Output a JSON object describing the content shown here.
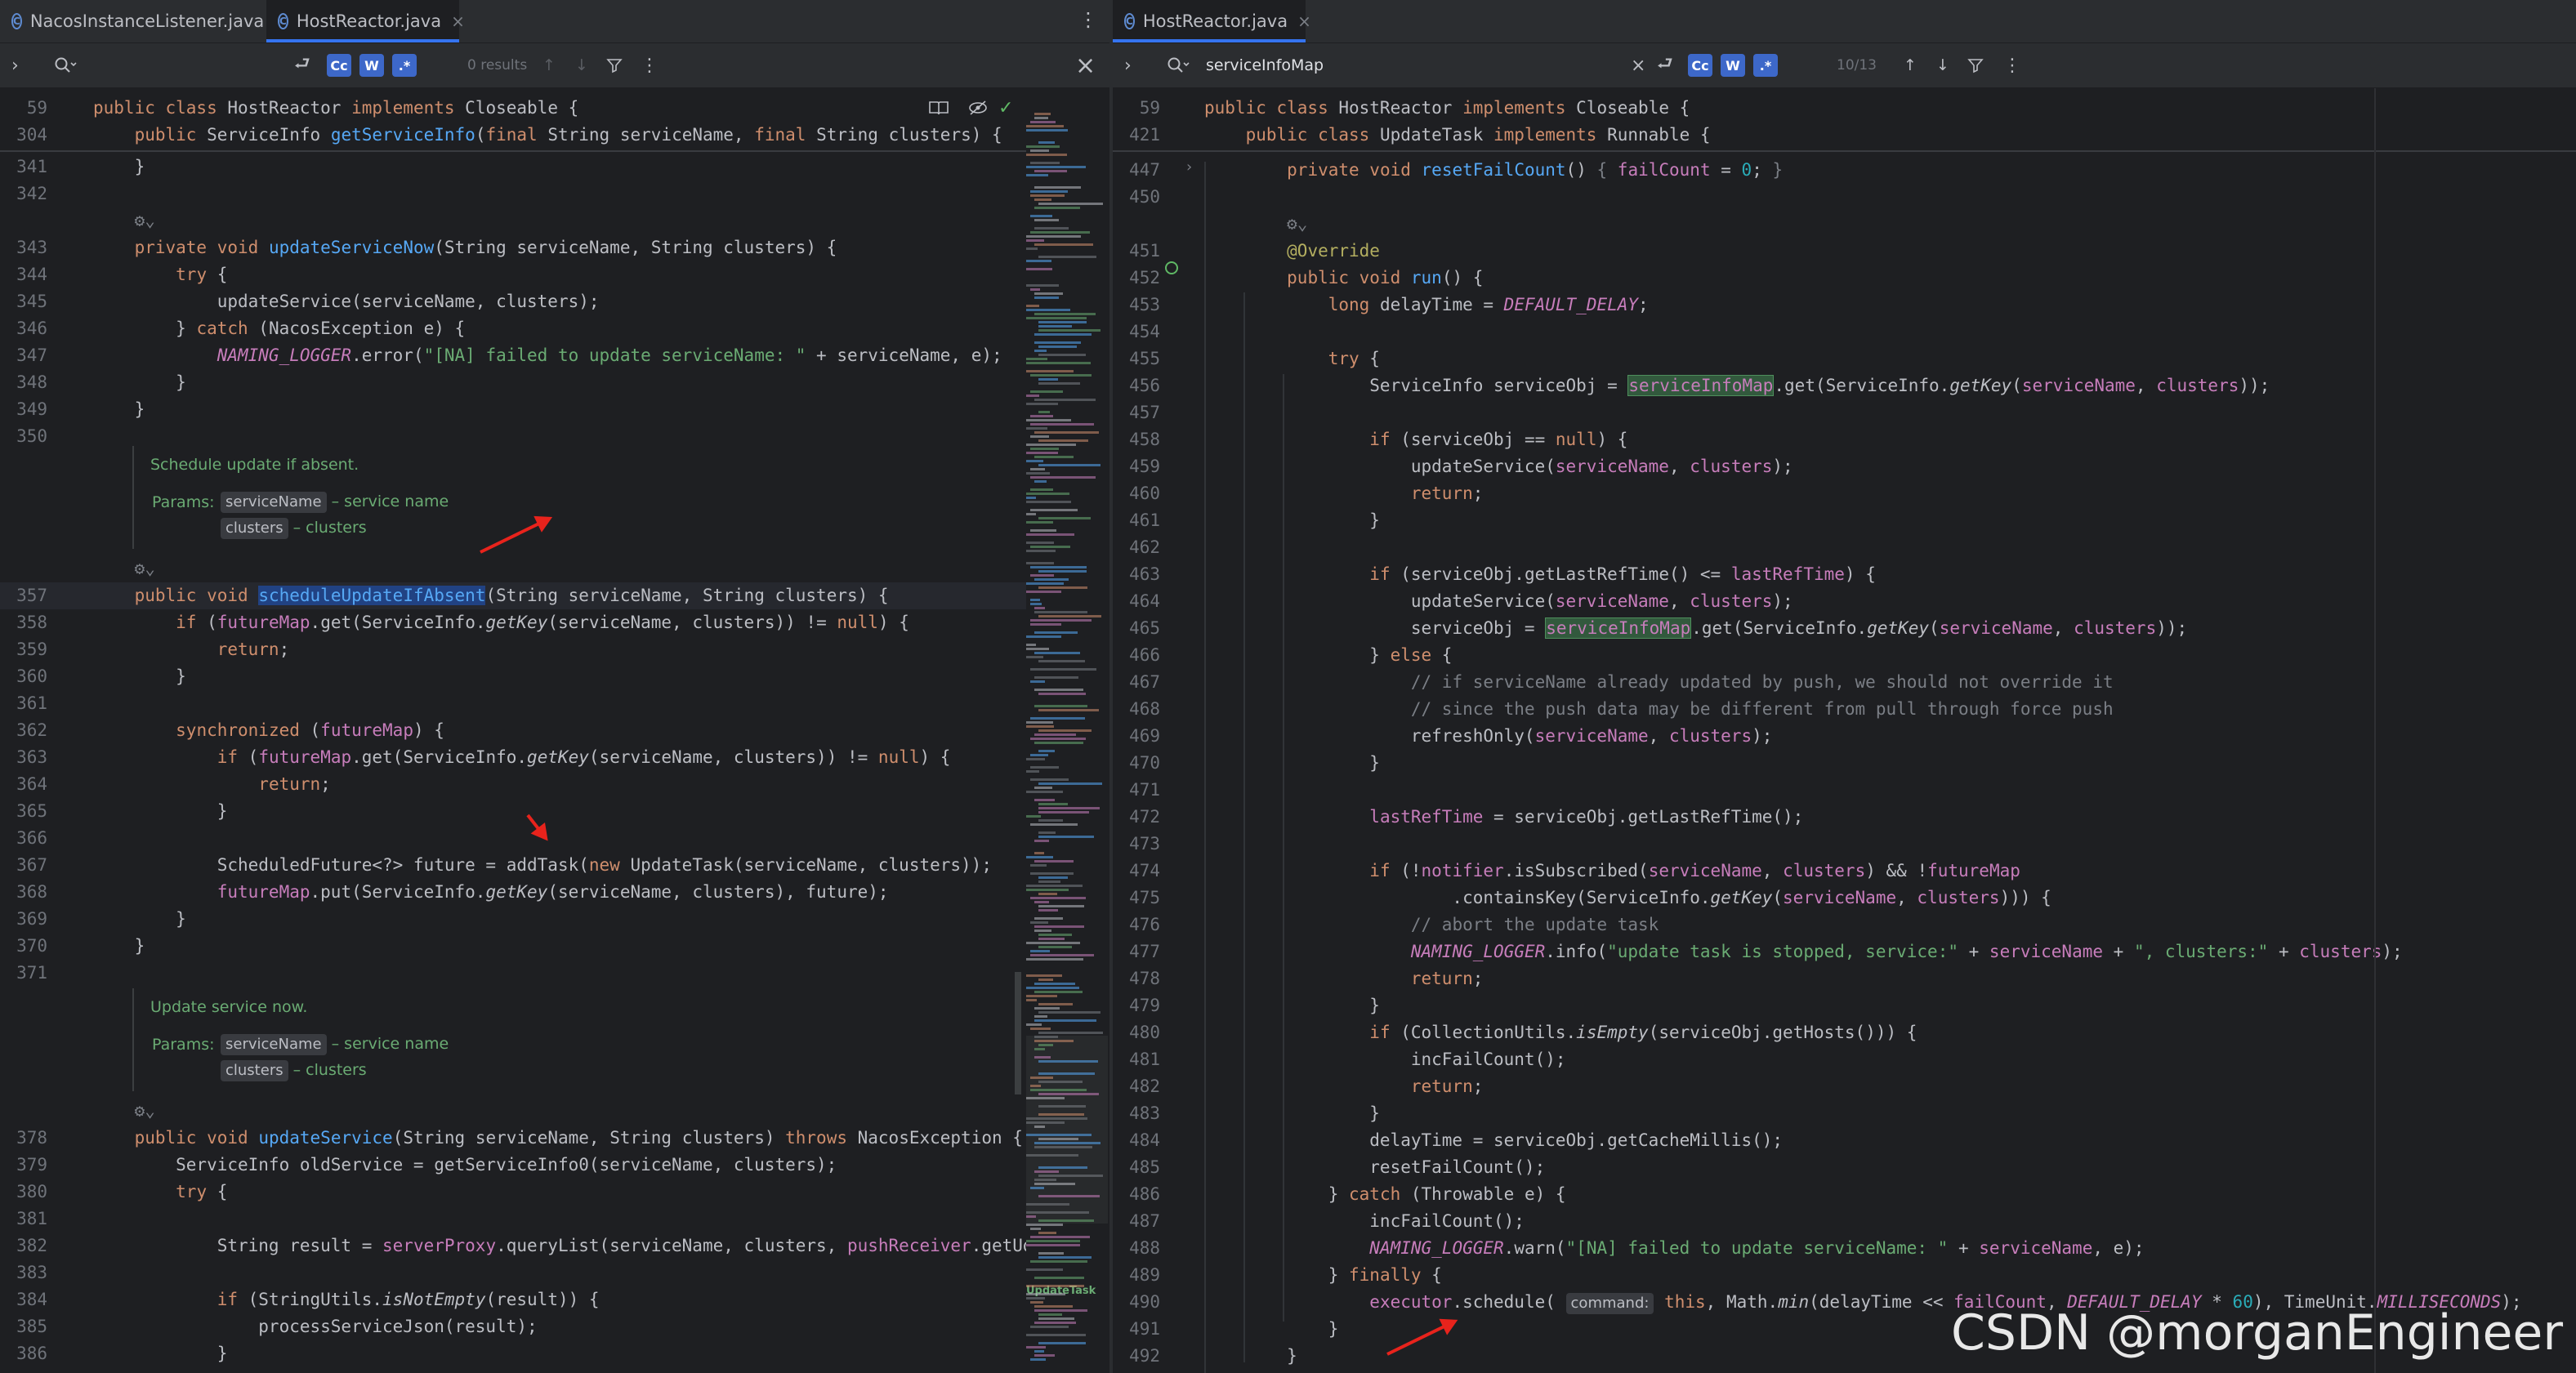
{
  "left": {
    "tabs": [
      {
        "label": "NacosInstanceListener.java",
        "active": false,
        "closable": false
      },
      {
        "label": "HostReactor.java",
        "active": true,
        "closable": true
      }
    ],
    "find": {
      "query": "",
      "results": "0 results",
      "toggles": [
        "Cc",
        "W",
        ".*"
      ]
    },
    "sticky": [
      {
        "num": "59",
        "html": "<span class='kw'>public class</span> HostReactor <span class='kw'>implements</span> Closeable {"
      },
      {
        "num": "304",
        "html": "    <span class='kw'>public</span> ServiceInfo <span class='fn'>getServiceInfo</span>(<span class='kw'>final</span> String serviceName, <span class='kw'>final</span> String clusters) {"
      }
    ],
    "lines": [
      {
        "num": "341",
        "html": "    }"
      },
      {
        "num": "342",
        "html": ""
      },
      {
        "num": "",
        "html": "    <span class='cm'>⚙⌄</span>"
      },
      {
        "num": "343",
        "html": "    <span class='kw'>private void</span> <span class='fn'>updateServiceNow</span>(String serviceName, String clusters) {"
      },
      {
        "num": "344",
        "html": "        <span class='kw'>try</span> {"
      },
      {
        "num": "345",
        "html": "            updateService(serviceName, clusters);"
      },
      {
        "num": "346",
        "html": "        } <span class='kw'>catch</span> (NacosException e) {"
      },
      {
        "num": "347",
        "html": "            <span class='cst'>NAMING_LOGGER</span>.error(<span class='st'>\"[NA] failed to update serviceName: \"</span> + serviceName, e);"
      },
      {
        "num": "348",
        "html": "        }"
      },
      {
        "num": "349",
        "html": "    }"
      },
      {
        "num": "350",
        "html": ""
      }
    ],
    "doc1": {
      "summary": "Schedule update if absent.",
      "params_label": "Params:",
      "params": [
        {
          "name": "serviceName",
          "desc": "– service name"
        },
        {
          "name": "clusters",
          "desc": "– clusters"
        }
      ]
    },
    "lines2": [
      {
        "num": "",
        "html": "    <span class='cm'>⚙⌄</span>"
      },
      {
        "num": "357",
        "html": "    <span class='kw'>public void</span> <span class='hl'>scheduleUpdateIfAbsent</span>(String serviceName, String clusters) {",
        "current": true
      },
      {
        "num": "358",
        "html": "        <span class='kw'>if</span> (<span class='fd'>futureMap</span>.get(ServiceInfo.<span class='it'>getKey</span>(serviceName, clusters)) != <span class='kw'>null</span>) {"
      },
      {
        "num": "359",
        "html": "            <span class='kw'>return</span>;"
      },
      {
        "num": "360",
        "html": "        }"
      },
      {
        "num": "361",
        "html": ""
      },
      {
        "num": "362",
        "html": "        <span class='kw'>synchronized</span> (<span class='fd'>futureMap</span>) {"
      },
      {
        "num": "363",
        "html": "            <span class='kw'>if</span> (<span class='fd'>futureMap</span>.get(ServiceInfo.<span class='it'>getKey</span>(serviceName, clusters)) != <span class='kw'>null</span>) {"
      },
      {
        "num": "364",
        "html": "                <span class='kw'>return</span>;"
      },
      {
        "num": "365",
        "html": "            }"
      },
      {
        "num": "366",
        "html": ""
      },
      {
        "num": "367",
        "html": "            ScheduledFuture&lt;?&gt; future = addTask(<span class='kw'>new</span> UpdateTask(serviceName, clusters));"
      },
      {
        "num": "368",
        "html": "            <span class='fd'>futureMap</span>.put(ServiceInfo.<span class='it'>getKey</span>(serviceName, clusters), future);"
      },
      {
        "num": "369",
        "html": "        }"
      },
      {
        "num": "370",
        "html": "    }"
      },
      {
        "num": "371",
        "html": ""
      }
    ],
    "doc2": {
      "summary": "Update service now.",
      "params_label": "Params:",
      "params": [
        {
          "name": "serviceName",
          "desc": "– service name"
        },
        {
          "name": "clusters",
          "desc": "– clusters"
        }
      ]
    },
    "lines3": [
      {
        "num": "",
        "html": "    <span class='cm'>⚙⌄</span>"
      },
      {
        "num": "378",
        "html": "    <span class='kw'>public void</span> <span class='fn'>updateService</span>(String serviceName, String clusters) <span class='kw'>throws</span> NacosException {"
      },
      {
        "num": "379",
        "html": "        ServiceInfo oldService = getServiceInfo0(serviceName, clusters);"
      },
      {
        "num": "380",
        "html": "        <span class='kw'>try</span> {"
      },
      {
        "num": "381",
        "html": ""
      },
      {
        "num": "382",
        "html": "            String result = <span class='fd'>serverProxy</span>.queryList(serviceName, clusters, <span class='fd'>pushReceiver</span>.getUdpPo"
      },
      {
        "num": "383",
        "html": ""
      },
      {
        "num": "384",
        "html": "            <span class='kw'>if</span> (StringUtils.<span class='it'>isNotEmpty</span>(result)) {"
      },
      {
        "num": "385",
        "html": "                processServiceJson(result);"
      },
      {
        "num": "386",
        "html": "            }"
      }
    ],
    "minimap_label": "UpdateTask"
  },
  "right": {
    "tabs": [
      {
        "label": "HostReactor.java",
        "active": true,
        "closable": true
      }
    ],
    "find": {
      "query": "serviceInfoMap",
      "results": "10/13",
      "toggles": [
        "Cc",
        "W",
        ".*"
      ]
    },
    "sticky": [
      {
        "num": "59",
        "html": "<span class='kw'>public class</span> HostReactor <span class='kw'>implements</span> Closeable {"
      },
      {
        "num": "421",
        "html": "    <span class='kw'>public class</span> UpdateTask <span class='kw'>implements</span> Runnable {"
      }
    ],
    "lines": [
      {
        "num": "447",
        "html": "        <span class='kw'>private void</span> <span class='fn'>resetFailCount</span>() <span class='cm'>{</span> <span class='fd'>failCount</span> = <span class='nm'>0</span>; <span class='cm'>}</span>"
      },
      {
        "num": "450",
        "html": ""
      },
      {
        "num": "",
        "html": "        <span class='cm'>⚙⌄</span>"
      },
      {
        "num": "451",
        "html": "        <span class='an'>@Override</span>"
      },
      {
        "num": "452",
        "html": "        <span class='kw'>public void</span> <span class='fn'>run</span>() {"
      },
      {
        "num": "453",
        "html": "            <span class='kw'>long</span> delayTime = <span class='cst'>DEFAULT_DELAY</span>;"
      },
      {
        "num": "454",
        "html": ""
      },
      {
        "num": "455",
        "html": "            <span class='kw'>try</span> {"
      },
      {
        "num": "456",
        "html": "                ServiceInfo serviceObj = <span class='srch fd'>serviceInfoMap</span>.get(ServiceInfo.<span class='it'>getKey</span>(<span class='fd'>serviceName</span>, <span class='fd'>clusters</span>));"
      },
      {
        "num": "457",
        "html": ""
      },
      {
        "num": "458",
        "html": "                <span class='kw'>if</span> (serviceObj == <span class='kw'>null</span>) {"
      },
      {
        "num": "459",
        "html": "                    updateService(<span class='fd'>serviceName</span>, <span class='fd'>clusters</span>);"
      },
      {
        "num": "460",
        "html": "                    <span class='kw'>return</span>;"
      },
      {
        "num": "461",
        "html": "                }"
      },
      {
        "num": "462",
        "html": ""
      },
      {
        "num": "463",
        "html": "                <span class='kw'>if</span> (serviceObj.getLastRefTime() &lt;= <span class='fd'>lastRefTime</span>) {"
      },
      {
        "num": "464",
        "html": "                    updateService(<span class='fd'>serviceName</span>, <span class='fd'>clusters</span>);"
      },
      {
        "num": "465",
        "html": "                    serviceObj = <span class='srch fd'>serviceInfoMap</span>.get(ServiceInfo.<span class='it'>getKey</span>(<span class='fd'>serviceName</span>, <span class='fd'>clusters</span>));"
      },
      {
        "num": "466",
        "html": "                } <span class='kw'>else</span> {"
      },
      {
        "num": "467",
        "html": "                    <span class='cm'>// if serviceName already updated by push, we should not override it</span>"
      },
      {
        "num": "468",
        "html": "                    <span class='cm'>// since the push data may be different from pull through force push</span>"
      },
      {
        "num": "469",
        "html": "                    refreshOnly(<span class='fd'>serviceName</span>, <span class='fd'>clusters</span>);"
      },
      {
        "num": "470",
        "html": "                }"
      },
      {
        "num": "471",
        "html": ""
      },
      {
        "num": "472",
        "html": "                <span class='fd'>lastRefTime</span> = serviceObj.getLastRefTime();"
      },
      {
        "num": "473",
        "html": ""
      },
      {
        "num": "474",
        "html": "                <span class='kw'>if</span> (!<span class='fd'>notifier</span>.isSubscribed(<span class='fd'>serviceName</span>, <span class='fd'>clusters</span>) &amp;&amp; !<span class='fd'>futureMap</span>"
      },
      {
        "num": "475",
        "html": "                        .containsKey(ServiceInfo.<span class='it'>getKey</span>(<span class='fd'>serviceName</span>, <span class='fd'>clusters</span>))) {"
      },
      {
        "num": "476",
        "html": "                    <span class='cm'>// abort the update task</span>"
      },
      {
        "num": "477",
        "html": "                    <span class='cst'>NAMING_LOGGER</span>.info(<span class='st'>\"update task is stopped, service:\"</span> + <span class='fd'>serviceName</span> + <span class='st'>\", clusters:\"</span> + <span class='fd'>clusters</span>);"
      },
      {
        "num": "478",
        "html": "                    <span class='kw'>return</span>;"
      },
      {
        "num": "479",
        "html": "                }"
      },
      {
        "num": "480",
        "html": "                <span class='kw'>if</span> (CollectionUtils.<span class='it'>isEmpty</span>(serviceObj.getHosts())) {"
      },
      {
        "num": "481",
        "html": "                    incFailCount();"
      },
      {
        "num": "482",
        "html": "                    <span class='kw'>return</span>;"
      },
      {
        "num": "483",
        "html": "                }"
      },
      {
        "num": "484",
        "html": "                delayTime = serviceObj.getCacheMillis();"
      },
      {
        "num": "485",
        "html": "                resetFailCount();"
      },
      {
        "num": "486",
        "html": "            } <span class='kw'>catch</span> (Throwable e) {"
      },
      {
        "num": "487",
        "html": "                incFailCount();"
      },
      {
        "num": "488",
        "html": "                <span class='cst'>NAMING_LOGGER</span>.warn(<span class='st'>\"[NA] failed to update serviceName: \"</span> + <span class='fd'>serviceName</span>, e);"
      },
      {
        "num": "489",
        "html": "            } <span class='kw'>finally</span> {"
      },
      {
        "num": "490",
        "html": "                <span class='fd'>executor</span>.schedule( <span class='chip'>command:</span> <span class='kw'>this</span>, Math.<span class='it'>min</span>(delayTime &lt;&lt; <span class='fd'>failCount</span>, <span class='cst'>DEFAULT_DELAY</span> * <span class='nm'>60</span>), TimeUnit.<span class='cst'>MILLISECONDS</span>);"
      },
      {
        "num": "491",
        "html": "            }"
      },
      {
        "num": "492",
        "html": "        }"
      }
    ]
  },
  "watermark": "CSDN @morganEngineer"
}
